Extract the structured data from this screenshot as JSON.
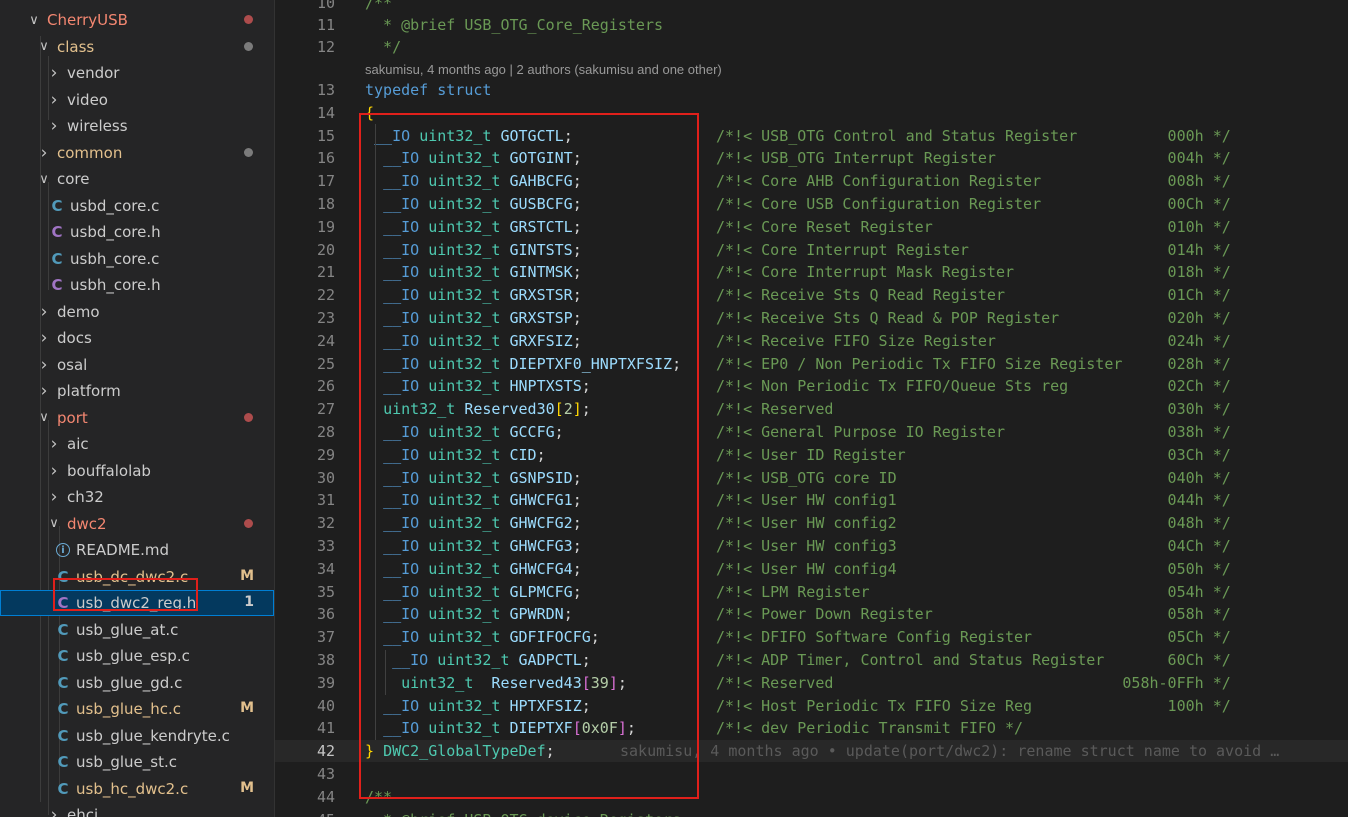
{
  "explorer": {
    "items": [
      {
        "label": "CherryUSB",
        "depth": 0,
        "kind": "folder",
        "open": true,
        "color": "red",
        "dot": "red"
      },
      {
        "label": "class",
        "depth": 1,
        "kind": "folder",
        "open": true,
        "color": "yellow",
        "dot": "grey"
      },
      {
        "label": "vendor",
        "depth": 2,
        "kind": "folder",
        "open": false
      },
      {
        "label": "video",
        "depth": 2,
        "kind": "folder",
        "open": false
      },
      {
        "label": "wireless",
        "depth": 2,
        "kind": "folder",
        "open": false
      },
      {
        "label": "common",
        "depth": 1,
        "kind": "folder",
        "open": false,
        "color": "yellow",
        "dot": "grey"
      },
      {
        "label": "core",
        "depth": 1,
        "kind": "folder",
        "open": true
      },
      {
        "label": "usbd_core.c",
        "depth": 2,
        "kind": "c"
      },
      {
        "label": "usbd_core.h",
        "depth": 2,
        "kind": "h"
      },
      {
        "label": "usbh_core.c",
        "depth": 2,
        "kind": "c"
      },
      {
        "label": "usbh_core.h",
        "depth": 2,
        "kind": "h"
      },
      {
        "label": "demo",
        "depth": 1,
        "kind": "folder",
        "open": false
      },
      {
        "label": "docs",
        "depth": 1,
        "kind": "folder",
        "open": false
      },
      {
        "label": "osal",
        "depth": 1,
        "kind": "folder",
        "open": false
      },
      {
        "label": "platform",
        "depth": 1,
        "kind": "folder",
        "open": false
      },
      {
        "label": "port",
        "depth": 1,
        "kind": "folder",
        "open": true,
        "color": "red",
        "dot": "red"
      },
      {
        "label": "aic",
        "depth": 2,
        "kind": "folder",
        "open": false
      },
      {
        "label": "bouffalolab",
        "depth": 2,
        "kind": "folder",
        "open": false
      },
      {
        "label": "ch32",
        "depth": 2,
        "kind": "folder",
        "open": false
      },
      {
        "label": "dwc2",
        "depth": 2,
        "kind": "folder",
        "open": true,
        "color": "red",
        "dot": "red"
      },
      {
        "label": "README.md",
        "depth": 3,
        "kind": "info"
      },
      {
        "label": "usb_dc_dwc2.c",
        "depth": 3,
        "kind": "c",
        "color": "yellow",
        "badge": "M"
      },
      {
        "label": "usb_dwc2_reg.h",
        "depth": 3,
        "kind": "h",
        "selected": true,
        "badge": "1"
      },
      {
        "label": "usb_glue_at.c",
        "depth": 3,
        "kind": "c"
      },
      {
        "label": "usb_glue_esp.c",
        "depth": 3,
        "kind": "c"
      },
      {
        "label": "usb_glue_gd.c",
        "depth": 3,
        "kind": "c"
      },
      {
        "label": "usb_glue_hc.c",
        "depth": 3,
        "kind": "c",
        "color": "yellow",
        "badge": "M"
      },
      {
        "label": "usb_glue_kendryte.c",
        "depth": 3,
        "kind": "c"
      },
      {
        "label": "usb_glue_st.c",
        "depth": 3,
        "kind": "c"
      },
      {
        "label": "usb_hc_dwc2.c",
        "depth": 3,
        "kind": "c",
        "color": "yellow",
        "badge": "M"
      },
      {
        "label": "ehci",
        "depth": 2,
        "kind": "folder",
        "open": false
      }
    ]
  },
  "editor": {
    "codelens": "sakumisu, 4 months ago | 2 authors (sakumisu and one other)",
    "blame": "sakumisu, 4 months ago • update(port/dwc2): rename struct name to avoid …",
    "top_lines": [
      {
        "n": "10",
        "text": "/**"
      },
      {
        "n": "11",
        "text": "  * @brief USB_OTG_Core_Registers"
      },
      {
        "n": "12",
        "text": "  */"
      }
    ],
    "typedef_line": {
      "n": "13",
      "kw1": "typedef",
      "kw2": "struct"
    },
    "open_brace_line": {
      "n": "14",
      "text": "{"
    },
    "registers": [
      {
        "n": "15",
        "mac": "__IO",
        "ty": "uint32_t",
        "name": "GOTGCTL",
        "comment": "/*!< USB_OTG Control and Status Register          000h */",
        "indent": 1
      },
      {
        "n": "16",
        "mac": "__IO",
        "ty": "uint32_t",
        "name": "GOTGINT",
        "comment": "/*!< USB_OTG Interrupt Register                   004h */",
        "indent": 2
      },
      {
        "n": "17",
        "mac": "__IO",
        "ty": "uint32_t",
        "name": "GAHBCFG",
        "comment": "/*!< Core AHB Configuration Register              008h */",
        "indent": 2
      },
      {
        "n": "18",
        "mac": "__IO",
        "ty": "uint32_t",
        "name": "GUSBCFG",
        "comment": "/*!< Core USB Configuration Register              00Ch */",
        "indent": 2
      },
      {
        "n": "19",
        "mac": "__IO",
        "ty": "uint32_t",
        "name": "GRSTCTL",
        "comment": "/*!< Core Reset Register                          010h */",
        "indent": 2
      },
      {
        "n": "20",
        "mac": "__IO",
        "ty": "uint32_t",
        "name": "GINTSTS",
        "comment": "/*!< Core Interrupt Register                      014h */",
        "indent": 2
      },
      {
        "n": "21",
        "mac": "__IO",
        "ty": "uint32_t",
        "name": "GINTMSK",
        "comment": "/*!< Core Interrupt Mask Register                 018h */",
        "indent": 2
      },
      {
        "n": "22",
        "mac": "__IO",
        "ty": "uint32_t",
        "name": "GRXSTSR",
        "comment": "/*!< Receive Sts Q Read Register                  01Ch */",
        "indent": 2
      },
      {
        "n": "23",
        "mac": "__IO",
        "ty": "uint32_t",
        "name": "GRXSTSP",
        "comment": "/*!< Receive Sts Q Read & POP Register            020h */",
        "indent": 2
      },
      {
        "n": "24",
        "mac": "__IO",
        "ty": "uint32_t",
        "name": "GRXFSIZ",
        "comment": "/*!< Receive FIFO Size Register                   024h */",
        "indent": 2
      },
      {
        "n": "25",
        "mac": "__IO",
        "ty": "uint32_t",
        "name": "DIEPTXF0_HNPTXFSIZ",
        "comment": "/*!< EP0 / Non Periodic Tx FIFO Size Register     028h */",
        "indent": 2
      },
      {
        "n": "26",
        "mac": "__IO",
        "ty": "uint32_t",
        "name": "HNPTXSTS",
        "comment": "/*!< Non Periodic Tx FIFO/Queue Sts reg           02Ch */",
        "indent": 2
      },
      {
        "n": "27",
        "mac": "",
        "ty": "uint32_t",
        "name": "Reserved30",
        "arr": "2",
        "comment": "/*!< Reserved                                     030h */",
        "indent": 2
      },
      {
        "n": "28",
        "mac": "__IO",
        "ty": "uint32_t",
        "name": "GCCFG",
        "comment": "/*!< General Purpose IO Register                  038h */",
        "indent": 2
      },
      {
        "n": "29",
        "mac": "__IO",
        "ty": "uint32_t",
        "name": "CID",
        "comment": "/*!< User ID Register                             03Ch */",
        "indent": 2
      },
      {
        "n": "30",
        "mac": "__IO",
        "ty": "uint32_t",
        "name": "GSNPSID",
        "comment": "/*!< USB_OTG core ID                              040h */",
        "indent": 2
      },
      {
        "n": "31",
        "mac": "__IO",
        "ty": "uint32_t",
        "name": "GHWCFG1",
        "comment": "/*!< User HW config1                              044h */",
        "indent": 2
      },
      {
        "n": "32",
        "mac": "__IO",
        "ty": "uint32_t",
        "name": "GHWCFG2",
        "comment": "/*!< User HW config2                              048h */",
        "indent": 2
      },
      {
        "n": "33",
        "mac": "__IO",
        "ty": "uint32_t",
        "name": "GHWCFG3",
        "comment": "/*!< User HW config3                              04Ch */",
        "indent": 2
      },
      {
        "n": "34",
        "mac": "__IO",
        "ty": "uint32_t",
        "name": "GHWCFG4",
        "comment": "/*!< User HW config4                              050h */",
        "indent": 2
      },
      {
        "n": "35",
        "mac": "__IO",
        "ty": "uint32_t",
        "name": "GLPMCFG",
        "comment": "/*!< LPM Register                                 054h */",
        "indent": 2
      },
      {
        "n": "36",
        "mac": "__IO",
        "ty": "uint32_t",
        "name": "GPWRDN",
        "comment": "/*!< Power Down Register                          058h */",
        "indent": 2
      },
      {
        "n": "37",
        "mac": "__IO",
        "ty": "uint32_t",
        "name": "GDFIFOCFG",
        "comment": "/*!< DFIFO Software Config Register               05Ch */",
        "indent": 2
      },
      {
        "n": "38",
        "mac": "__IO",
        "ty": "uint32_t",
        "name": "GADPCTL",
        "comment": "/*!< ADP Timer, Control and Status Register       60Ch */",
        "indent": 3
      },
      {
        "n": "39",
        "mac": "",
        "ty": "uint32_t",
        "name": " Reserved43",
        "arr": "39",
        "comment": "/*!< Reserved                                058h-0FFh */",
        "indent": 3
      },
      {
        "n": "40",
        "mac": "__IO",
        "ty": "uint32_t",
        "name": "HPTXFSIZ",
        "comment": "/*!< Host Periodic Tx FIFO Size Reg               100h */",
        "indent": 2
      },
      {
        "n": "41",
        "mac": "__IO",
        "ty": "uint32_t",
        "name": "DIEPTXF",
        "arr": "0x0F",
        "comment": "/*!< dev Periodic Transmit FIFO */",
        "indent": 2
      }
    ],
    "close_line": {
      "n": "42",
      "brace": "}",
      "name": "DWC2_GlobalTypeDef",
      "semi": ";"
    },
    "bottom_lines": [
      {
        "n": "43",
        "text": ""
      },
      {
        "n": "44",
        "text": "/**"
      },
      {
        "n": "45",
        "text": "  * @brief USB_OTG_device_Registers"
      }
    ]
  }
}
